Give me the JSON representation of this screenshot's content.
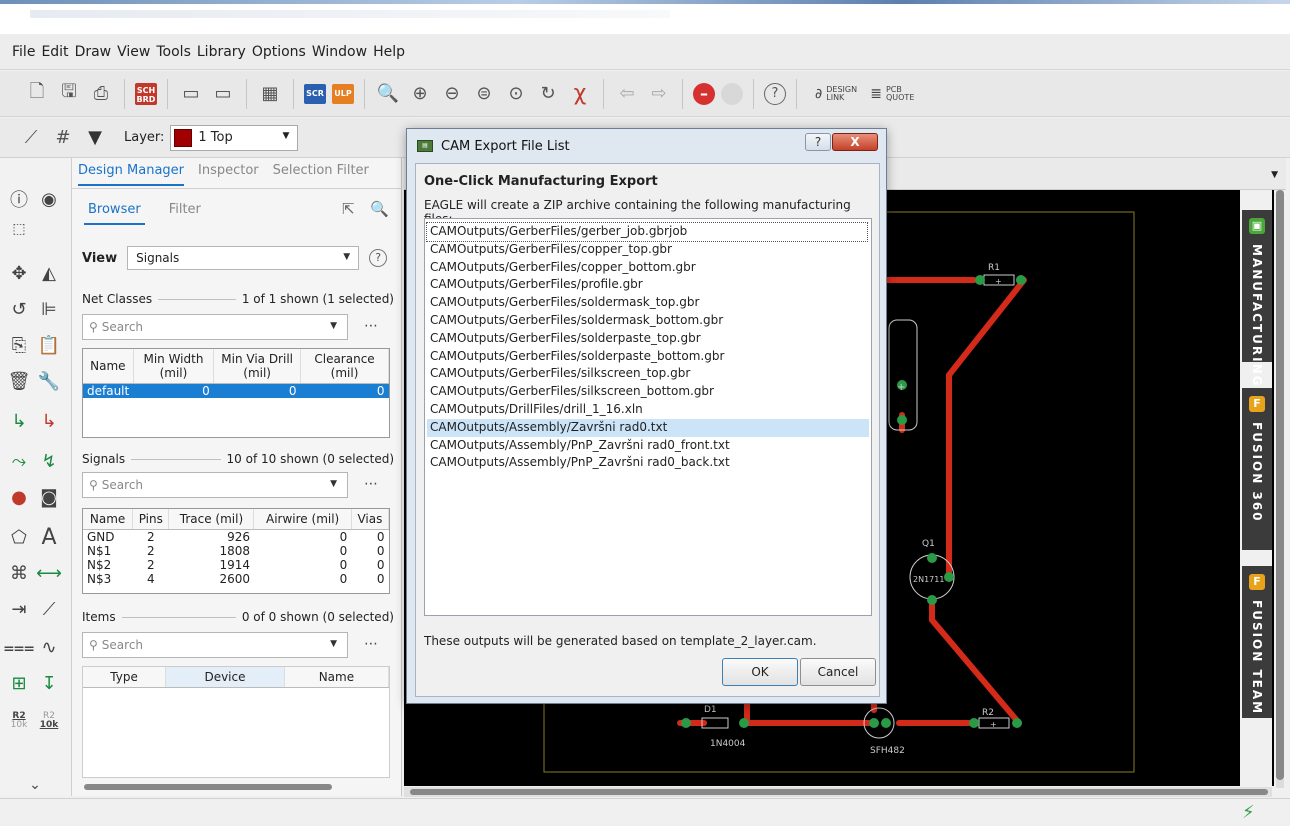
{
  "menu": [
    "File",
    "Edit",
    "Draw",
    "View",
    "Tools",
    "Library",
    "Options",
    "Window",
    "Help"
  ],
  "toolbar": {
    "sch_brd_label": "SCH BRD",
    "scr_label": "SCR",
    "ulp_label": "ULP",
    "design_link": "DESIGN LINK",
    "pcb_quote": "PCB QUOTE"
  },
  "toolbar2": {
    "layer_label": "Layer:",
    "layer_value": "1 Top",
    "layer_color": "#a00000"
  },
  "panel": {
    "tabs": [
      "Design Manager",
      "Inspector",
      "Selection Filter"
    ],
    "subtabs": [
      "Browser",
      "Filter"
    ],
    "view_label": "View",
    "view_value": "Signals",
    "net_classes": {
      "title": "Net Classes",
      "count": "1 of 1 shown (1 selected)",
      "search_placeholder": "Search",
      "columns": [
        "Name",
        "Min Width (mil)",
        "Min Via Drill (mil)",
        "Clearance (mil)"
      ],
      "rows": [
        [
          "default",
          "0",
          "0",
          "0"
        ]
      ]
    },
    "signals": {
      "title": "Signals",
      "count": "10 of 10 shown (0 selected)",
      "search_placeholder": "Search",
      "columns": [
        "Name",
        "Pins",
        "Trace (mil)",
        "Airwire (mil)",
        "Vias"
      ],
      "rows": [
        [
          "GND",
          "2",
          "926",
          "0",
          "0"
        ],
        [
          "N$1",
          "2",
          "1808",
          "0",
          "0"
        ],
        [
          "N$2",
          "2",
          "1914",
          "0",
          "0"
        ],
        [
          "N$3",
          "4",
          "2600",
          "0",
          "0"
        ]
      ]
    },
    "items": {
      "title": "Items",
      "count": "0 of 0 shown (0 selected)",
      "search_placeholder": "Search",
      "columns": [
        "Type",
        "Device",
        "Name"
      ]
    }
  },
  "left_tools": {
    "r2_label": "R2",
    "r2_value": "10k"
  },
  "right_tabs": [
    "MANUFACTURING",
    "FUSION 360",
    "FUSION TEAM"
  ],
  "board_labels": {
    "r1": "R1",
    "r2": "R2",
    "q1": "Q1",
    "q1_part": "2N1711",
    "d1": "D1",
    "d1_part": "1N4004",
    "sfh": "SFH482"
  },
  "dialog": {
    "title": "CAM Export File List",
    "heading": "One-Click Manufacturing Export",
    "description": "EAGLE will create a ZIP archive containing the following manufacturing files:",
    "files": [
      "CAMOutputs/GerberFiles/gerber_job.gbrjob",
      "CAMOutputs/GerberFiles/copper_top.gbr",
      "CAMOutputs/GerberFiles/copper_bottom.gbr",
      "CAMOutputs/GerberFiles/profile.gbr",
      "CAMOutputs/GerberFiles/soldermask_top.gbr",
      "CAMOutputs/GerberFiles/soldermask_bottom.gbr",
      "CAMOutputs/GerberFiles/solderpaste_top.gbr",
      "CAMOutputs/GerberFiles/solderpaste_bottom.gbr",
      "CAMOutputs/GerberFiles/silkscreen_top.gbr",
      "CAMOutputs/GerberFiles/silkscreen_bottom.gbr",
      "CAMOutputs/DrillFiles/drill_1_16.xln",
      "CAMOutputs/Assembly/Završni rad0.txt",
      "CAMOutputs/Assembly/PnP_Završni rad0_front.txt",
      "CAMOutputs/Assembly/PnP_Završni rad0_back.txt"
    ],
    "selected_index": 11,
    "footer": "These outputs will be generated based on template_2_layer.cam.",
    "ok": "OK",
    "cancel": "Cancel",
    "help": "?",
    "close": "X"
  }
}
